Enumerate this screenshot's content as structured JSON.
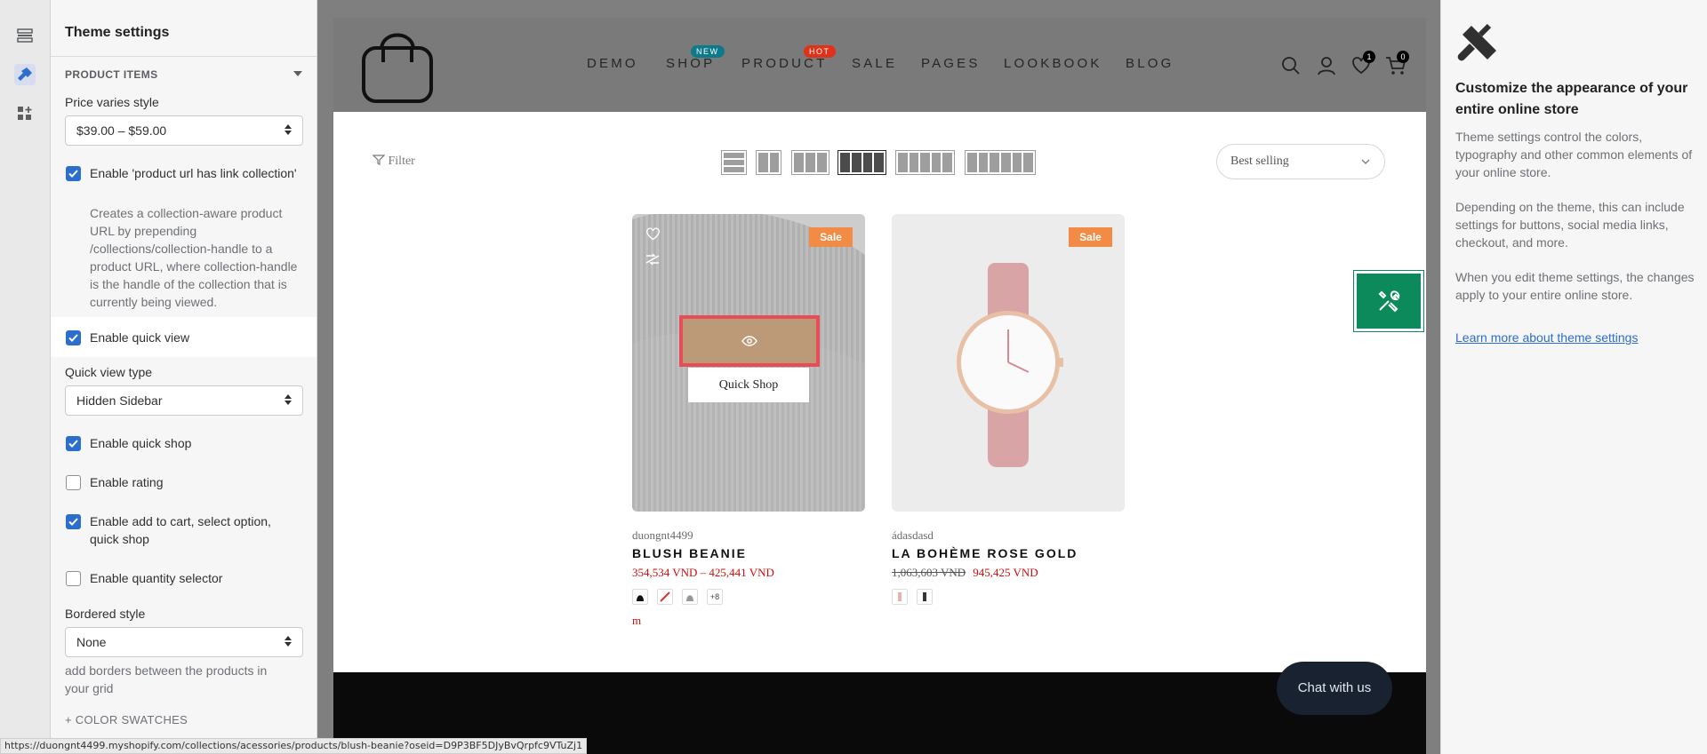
{
  "rail": {
    "icons": [
      "sections-icon",
      "theme-brush-icon",
      "add-app-block-icon"
    ]
  },
  "panel": {
    "title": "Theme settings",
    "section_head": "PRODUCT ITEMS",
    "price_style_label": "Price varies style",
    "price_style_value": "$39.00 – $59.00",
    "opt_url": {
      "label": "Enable 'product url has link collection'",
      "checked": true,
      "help": "Creates a collection-aware product URL by prepending /collections/collection-handle to a product URL, where collection-handle is the handle of the collection that is currently being viewed."
    },
    "opt_quickview": {
      "label": "Enable quick view",
      "checked": true
    },
    "quickview_type_label": "Quick view type",
    "quickview_type_value": "Hidden Sidebar",
    "opt_quickshop": {
      "label": "Enable quick shop",
      "checked": true
    },
    "opt_rating": {
      "label": "Enable rating",
      "checked": false
    },
    "opt_addtocart": {
      "label": "Enable add to cart, select option, quick shop",
      "checked": true
    },
    "opt_qty": {
      "label": "Enable quantity selector",
      "checked": false
    },
    "bordered_label": "Bordered style",
    "bordered_value": "None",
    "bordered_help": "add borders between the products in your grid",
    "color_swatches": "+ COLOR SWATCHES"
  },
  "store": {
    "nav": [
      "DEMO",
      "SHOP",
      "PRODUCT",
      "SALE",
      "PAGES",
      "LOOKBOOK",
      "BLOG"
    ],
    "badge_new": "NEW",
    "badge_hot": "HOT",
    "wishlist_count": "1",
    "cart_count": "0",
    "filter_label": "Filter",
    "sort_value": "Best selling",
    "active_grid_columns": 4,
    "quick_shop_label": "Quick Shop",
    "chat_label": "Chat with us",
    "products": [
      {
        "vendor": "duongnt4499",
        "title": "BLUSH BEANIE",
        "price": "354,534 VND – 425,441 VND",
        "old_price": "",
        "sale_badge": "Sale",
        "extra_swatches": "+8",
        "extra_text": "m"
      },
      {
        "vendor": "ádasdasd",
        "title": "LA BOHÈME ROSE GOLD",
        "price": "945,425 VND",
        "old_price": "1,063,603 VND",
        "sale_badge": "Sale"
      }
    ]
  },
  "right": {
    "title": "Customize the appearance of your entire online store",
    "p1": "Theme settings control the colors, typography and other common elements of your online store.",
    "p2": "Depending on the theme, this can include settings for buttons, social media links, checkout, and more.",
    "p3": "When you edit theme settings, the changes apply to your entire online store.",
    "link": "Learn more about theme settings"
  },
  "status_url": "https://duongnt4499.myshopify.com/collections/acessories/products/blush-beanie?oseid=D9P3BF5DJyBvQrpfc9VTuZj1",
  "colors": {
    "accent": "#2c6ecb",
    "sale": "#f28b45",
    "price_red": "#d20b0b",
    "tools_green": "#0d8a5c",
    "highlight": "#e74c5b"
  }
}
